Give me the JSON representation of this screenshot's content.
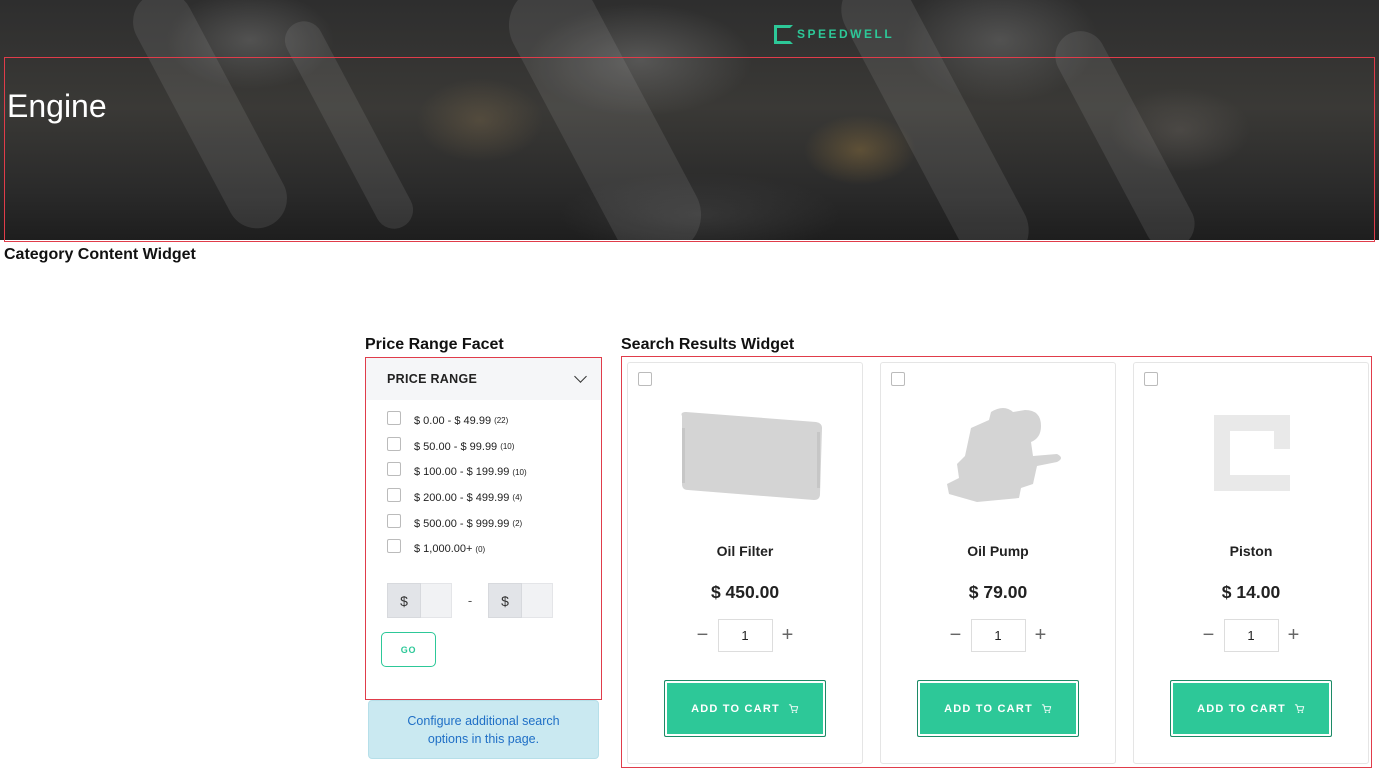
{
  "hero": {
    "logo_text": "SPEEDWELL",
    "title": "Engine",
    "brand_color": "#2dc898"
  },
  "labels": {
    "category_widget": "Category Content Widget",
    "price_facet_widget": "Price Range Facet",
    "search_results_widget": "Search Results Widget"
  },
  "facet": {
    "title": "PRICE RANGE",
    "ranges": [
      {
        "label": "$ 0.00 - $ 49.99",
        "count": "(22)"
      },
      {
        "label": "$ 50.00 - $ 99.99",
        "count": "(10)"
      },
      {
        "label": "$ 100.00 - $ 199.99",
        "count": "(10)"
      },
      {
        "label": "$ 200.00 - $ 499.99",
        "count": "(4)"
      },
      {
        "label": "$ 500.00 - $ 999.99",
        "count": "(2)"
      },
      {
        "label": "$ 1,000.00+",
        "count": "(0)"
      }
    ],
    "min_currency": "$",
    "max_currency": "$",
    "separator": "-",
    "go_label": "GO"
  },
  "configure_note": "Configure additional search options in this page.",
  "products": [
    {
      "name": "Oil Filter",
      "price": "$ 450.00",
      "qty": "1",
      "add_label": "ADD TO CART",
      "image": "oil-filter-image"
    },
    {
      "name": "Oil Pump",
      "price": "$ 79.00",
      "qty": "1",
      "add_label": "ADD TO CART",
      "image": "oil-pump-image"
    },
    {
      "name": "Piston",
      "price": "$ 14.00",
      "qty": "1",
      "add_label": "ADD TO CART",
      "image": "placeholder-logo-image"
    }
  ]
}
